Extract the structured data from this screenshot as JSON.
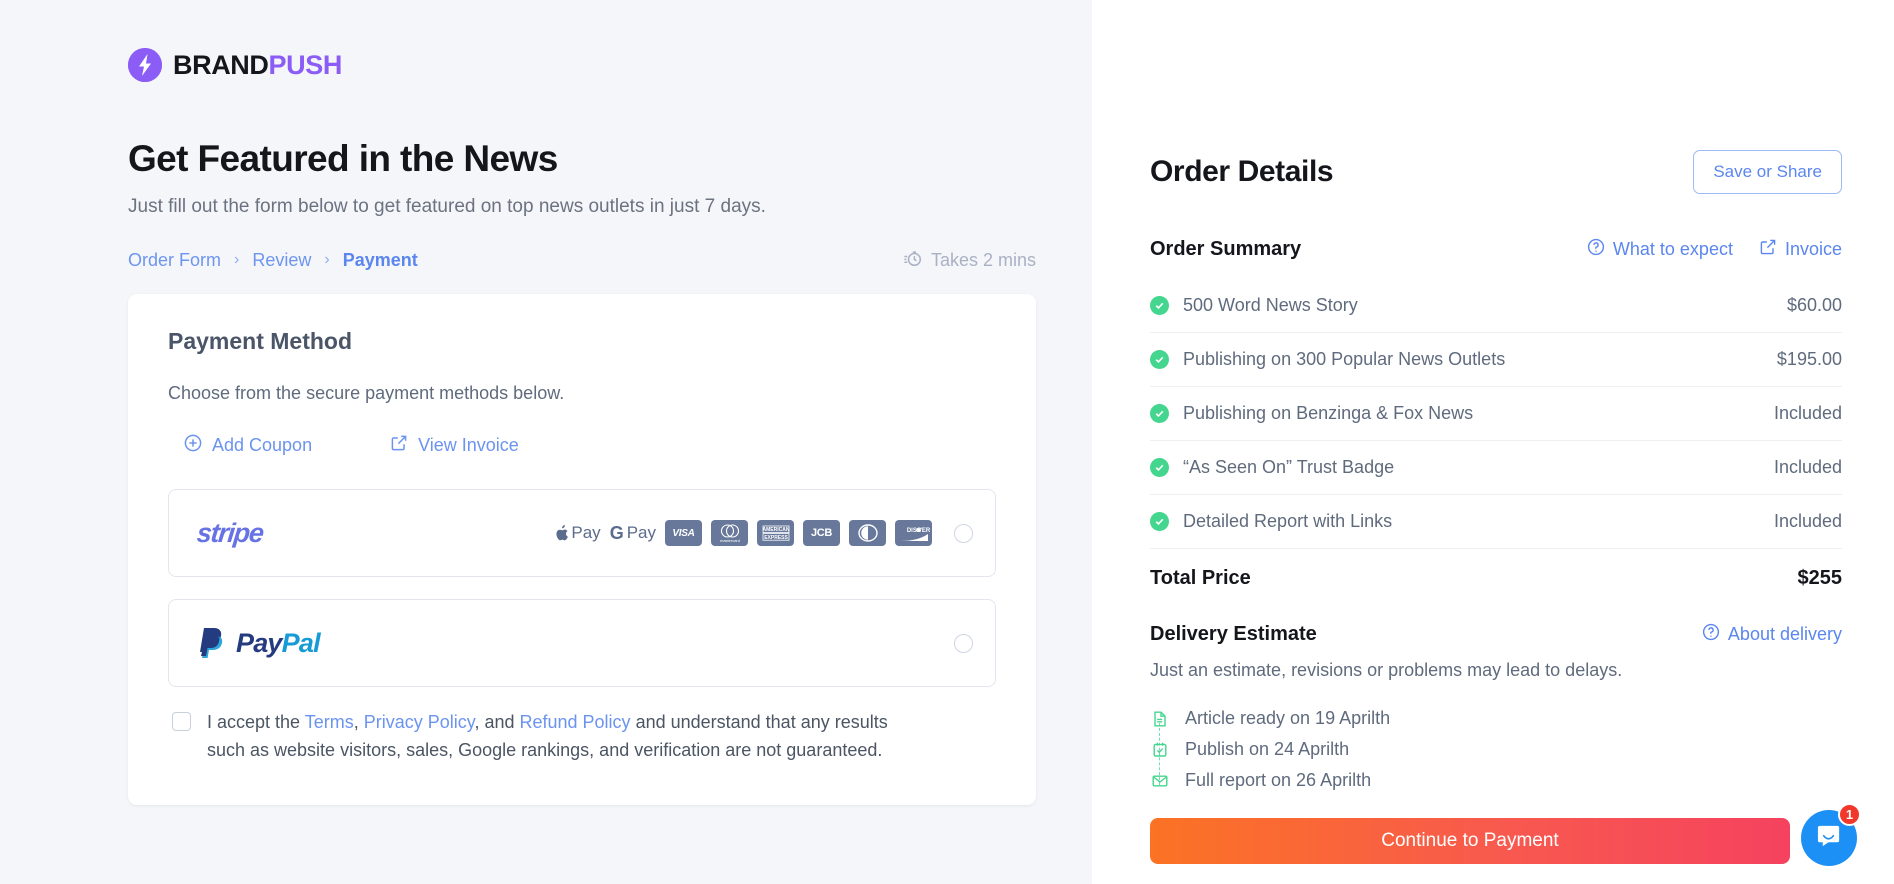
{
  "brand": {
    "name_dark": "BRAND",
    "name_accent": "PUSH",
    "accent_color": "#8b5cf6"
  },
  "header": {
    "title": "Get Featured in the News",
    "subtitle": "Just fill out the form below to get featured on top news outlets in just 7 days."
  },
  "breadcrumb": {
    "items": [
      {
        "label": "Order Form",
        "active": false
      },
      {
        "label": "Review",
        "active": false
      },
      {
        "label": "Payment",
        "active": true
      }
    ],
    "separator": "›",
    "takes_label": "Takes 2 mins",
    "takes_icon": "stopwatch-icon"
  },
  "payment": {
    "title": "Payment Method",
    "subtitle": "Choose from the secure payment methods below.",
    "actions": [
      {
        "label": "Add Coupon",
        "icon": "plus-circle-icon"
      },
      {
        "label": "View Invoice",
        "icon": "external-link-icon"
      }
    ],
    "methods": [
      {
        "id": "stripe",
        "logo_text": "stripe",
        "logo_color": "#6772e5",
        "selected": false,
        "card_logos": [
          "Apple Pay",
          "G Pay",
          "VISA",
          "mastercard",
          "AMERICAN EXPRESS",
          "JCB",
          "Diners Club",
          "DISCOVER"
        ]
      },
      {
        "id": "paypal",
        "logo_text_1": "Pay",
        "logo_text_2": "Pal",
        "logo_color_1": "#253b80",
        "logo_color_2": "#179bd7",
        "selected": false
      }
    ],
    "terms": {
      "checked": false,
      "prefix": "I accept the ",
      "link1": "Terms",
      "mid1": ", ",
      "link2": "Privacy Policy",
      "mid2": ", and ",
      "link3": "Refund Policy",
      "suffix": " and understand that any results such as website visitors, sales, Google rankings, and verification are not guaranteed."
    }
  },
  "order": {
    "title": "Order Details",
    "save_share_label": "Save or Share",
    "summary_title": "Order Summary",
    "summary_links": [
      {
        "label": "What to expect",
        "icon": "question-circle-icon"
      },
      {
        "label": "Invoice",
        "icon": "external-link-icon"
      }
    ],
    "items": [
      {
        "label": "500 Word News Story",
        "value": "$60.00"
      },
      {
        "label": "Publishing on 300 Popular News Outlets",
        "value": "$195.00"
      },
      {
        "label": "Publishing on Benzinga & Fox News",
        "value": "Included"
      },
      {
        "label": "“As Seen On” Trust Badge",
        "value": "Included"
      },
      {
        "label": "Detailed Report with Links",
        "value": "Included"
      }
    ],
    "total_label": "Total Price",
    "total_value": "$255"
  },
  "delivery": {
    "title": "Delivery Estimate",
    "about_link": "About delivery",
    "about_icon": "question-circle-icon",
    "note": "Just an estimate, revisions or problems may lead to delays.",
    "steps": [
      {
        "label": "Article ready on 19 Aprilth",
        "icon": "document-icon"
      },
      {
        "label": "Publish on 24 Aprilth",
        "icon": "calendar-check-icon"
      },
      {
        "label": "Full report on 26 Aprilth",
        "icon": "envelope-icon"
      }
    ],
    "accent_color": "#44d68e"
  },
  "cta": {
    "label": "Continue to Payment",
    "gradient_from": "#fb7324",
    "gradient_to": "#f5425f"
  },
  "chat": {
    "badge_count": "1",
    "icon": "chat-bubble-icon",
    "color": "#1d90f5"
  }
}
